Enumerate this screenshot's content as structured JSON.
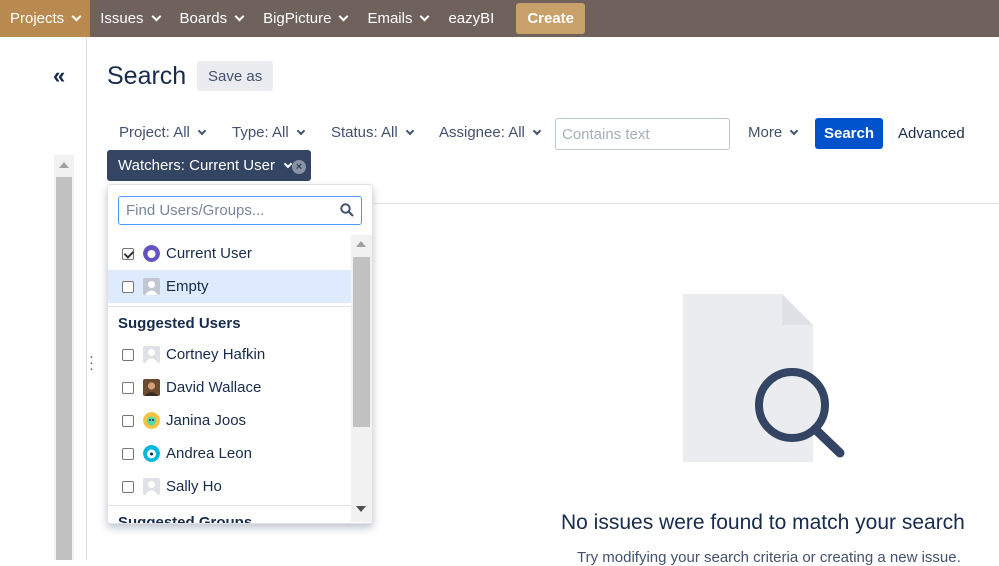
{
  "nav": {
    "items": [
      {
        "label": "Projects"
      },
      {
        "label": "Issues"
      },
      {
        "label": "Boards"
      },
      {
        "label": "BigPicture"
      },
      {
        "label": "Emails"
      },
      {
        "label": "eazyBI"
      }
    ],
    "create_label": "Create"
  },
  "sidebar": {
    "collapse_glyph": "«"
  },
  "page": {
    "title": "Search",
    "save_as_label": "Save as"
  },
  "filters": {
    "project": "Project: All",
    "type": "Type: All",
    "status": "Status: All",
    "assignee": "Assignee: All",
    "text_placeholder": "Contains text",
    "more": "More",
    "search_button": "Search",
    "advanced": "Advanced",
    "watchers": "Watchers: Current User"
  },
  "dropdown": {
    "search_placeholder": "Find Users/Groups...",
    "items": [
      {
        "label": "Current User",
        "checked": true
      },
      {
        "label": "Empty",
        "checked": false
      }
    ],
    "suggested_users_heading": "Suggested Users",
    "suggested_users": [
      {
        "label": "Cortney Hafkin"
      },
      {
        "label": "David Wallace"
      },
      {
        "label": "Janina Joos"
      },
      {
        "label": "Andrea Leon"
      },
      {
        "label": "Sally Ho"
      }
    ],
    "suggested_groups_heading": "Suggested Groups"
  },
  "empty_state": {
    "message": "No issues were found to match your search",
    "sub": "Try modifying your search criteria or creating a new issue."
  },
  "colors": {
    "nav_bg": "#6f625c",
    "nav_active": "#b88a4f",
    "create_bg": "#c8a16a",
    "primary": "#0052cc",
    "chip_bg": "#344563"
  }
}
